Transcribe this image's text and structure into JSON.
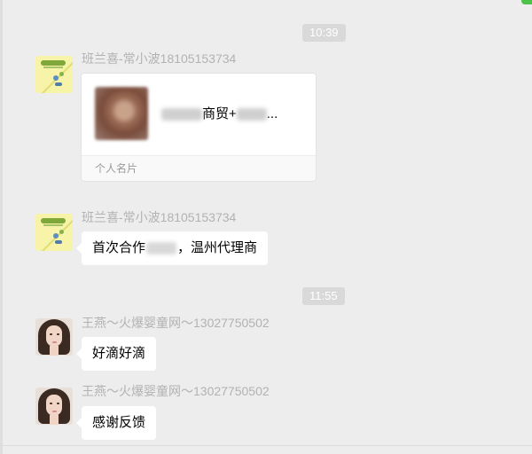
{
  "messages": {
    "time1": "10:39",
    "time2": "11:55",
    "m1": {
      "sender": "班兰喜-常小波18105153734",
      "card": {
        "name_visible_a": "商贸+",
        "name_visible_b": "...",
        "type": "个人名片"
      }
    },
    "m2": {
      "sender": "班兰喜-常小波18105153734",
      "text_a": "首次合作",
      "text_b": "，温州代理商"
    },
    "m3": {
      "sender": "王燕～火爆婴童网～13027750502",
      "text": "好滴好滴"
    },
    "m4": {
      "sender": "王燕～火爆婴童网～13027750502",
      "text": "感谢反馈"
    }
  },
  "colors": {
    "background": "#ededed",
    "bubble": "#ffffff",
    "timestamp_bg": "#d9d9d9",
    "sender_name": "#b2b2b2"
  }
}
